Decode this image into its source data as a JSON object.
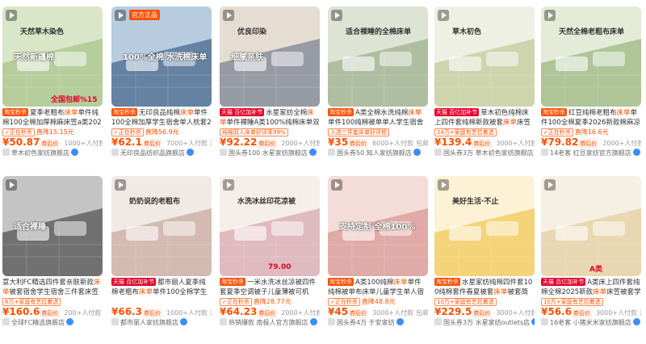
{
  "products": [
    {
      "badge": "",
      "overlay_top": "天然草木染色",
      "overlay_mid": "天然新疆棉",
      "overlay_bottom": "全国包邮%15",
      "tag": "淘宝秒杀",
      "title_pre": "夏季老粗布",
      "title_hl": "床单",
      "title_post": "单件纯棉100全棉加厚棉麻床笠a类2026",
      "promo_badge": "✓正在秒杀",
      "promo_text": "直降15.15元",
      "price": "¥50.87",
      "price_suffix": "券后价",
      "sales": "1000+人付款",
      "ship": "包邮",
      "shop": "草木初色家纺旗舰店",
      "bg1": "#d9e6c8",
      "bg2": "#a9c48e"
    },
    {
      "badge": "官方正品",
      "overlay_top": "",
      "overlay_mid": "100%全棉 水洗棉床单",
      "overlay_bottom": "",
      "tag": "淘宝秒杀",
      "title_pre": "无印良品纯棉",
      "title_hl": "床单",
      "title_post": "单件100全棉加厚学生宿舍单人枕套2026",
      "promo_badge": "✓正在秒杀",
      "promo_text": "直降56.9元",
      "price": "¥62.1",
      "price_suffix": "券后价",
      "sales": "7000+人付款",
      "ship": "江苏",
      "shop": "无印良品纺织品旗舰店",
      "bg1": "#b8cce0",
      "bg2": "#4a6a8e"
    },
    {
      "badge": "",
      "overlay_top": "优良印染",
      "overlay_mid": "细腻亲肤",
      "overlay_bottom": "",
      "tag": "天猫 百亿加补节",
      "title_pre": "水星家纺全棉",
      "title_hl": "床单",
      "title_post": "单件裸睡A类100%纯棉床单双人",
      "promo_badge": "纯棉双人床单好评率99%",
      "promo_text": "",
      "price": "¥92.22",
      "price_suffix": "券后价",
      "sales": "2000+人付款",
      "ship": "包邮",
      "shop": "国头券100 水星家纺旗舰店",
      "bg1": "#e6ddd2",
      "bg2": "#7b8494"
    },
    {
      "badge": "",
      "overlay_top": "适合裸睡的全棉床单",
      "overlay_mid": "",
      "overlay_bottom": "",
      "tag": "淘宝秒杀",
      "title_pre": "A类全棉水洗纯棉",
      "title_hl": "床单",
      "title_post": "单件100纯棉被单单人学生宿舍单人被单",
      "promo_badge": "入选三件套床单好评榜",
      "promo_text": "",
      "price": "¥35",
      "price_suffix": "券后价",
      "sales": "6000+人付款",
      "ship": "包邮",
      "shop": "国头券50 知人家纺旗舰店",
      "bg1": "#dde4d4",
      "bg2": "#9fb08f"
    },
    {
      "badge": "",
      "overlay_top": "草木初色",
      "overlay_mid": "",
      "overlay_bottom": "",
      "tag": "天猫 百亿加补节",
      "title_pre": "草木初色纯棉床上四件套纯棉新款被套",
      "title_hl": "床单",
      "title_post": "床笠单人",
      "promo_badge": "24万+家庭有艺拉着选",
      "promo_text": "",
      "price": "¥139.4",
      "price_suffix": "券后价",
      "sales": "3000+人付款",
      "ship": "包邮",
      "shop": "国头券3万 草木初色家纺旗舰店",
      "bg1": "#eef0e4",
      "bg2": "#c3cc9b"
    },
    {
      "badge": "",
      "overlay_top": "天然全棉老粗布床单",
      "overlay_mid": "",
      "overlay_bottom": "",
      "tag": "淘宝秒杀",
      "title_pre": "红豆纯棉老粗布",
      "title_hl": "床单",
      "title_post": "单件100全棉夏季2026新款棉麻凉爽床",
      "promo_badge": "✓正在秒杀",
      "promo_text": "直降16.6元",
      "price": "¥79.82",
      "price_suffix": "券后价",
      "sales": "2000+人付款",
      "ship": "江苏",
      "shop": "14老客 红豆家纺官方旗舰店",
      "bg1": "#e4ecd8",
      "bg2": "#9db883"
    },
    {
      "badge": "",
      "overlay_top": "",
      "overlay_mid": "适合裸睡",
      "overlay_bottom": "",
      "tag": "",
      "title_pre": "意大利FC精选四件套亲肤新款",
      "title_hl": "床单",
      "title_post": "被套宿舍学生宿舍三件套床笠床上",
      "promo_badge": "6万+家庭有艺拉着选",
      "promo_text": "",
      "price": "¥160.6",
      "price_suffix": "券后价",
      "sales": "200+人付款",
      "ship": "包邮",
      "shop": "全球FC精选旗舰店",
      "bg1": "#c4c4c4",
      "bg2": "#555555"
    },
    {
      "badge": "",
      "overlay_top": "奶奶说的老粗布",
      "overlay_mid": "",
      "overlay_bottom": "",
      "tag": "天猫 百亿加补节",
      "title_pre": "都市丽人夏季纯棉老粗布",
      "title_hl": "床单",
      "title_post": "单件100全棉学生宿舍单人",
      "promo_badge": "",
      "promo_text": "",
      "price": "¥66.3",
      "price_suffix": "券后价",
      "sales": "1000+人付款",
      "ship": "江苏",
      "shop": "都市丽人家纺旗舰店",
      "bg1": "#f1e9e4",
      "bg2": "#c9a9a0"
    },
    {
      "badge": "",
      "overlay_top": "水洗冰丝印花凉被",
      "overlay_mid": "",
      "overlay_bottom": "79.00",
      "tag": "淘宝秒杀",
      "title_pre": "一米水洗冰丝凉被四件套夏季空调被子儿童薄被可机",
      "title_hl": "",
      "title_post": "",
      "promo_badge": "✓正在秒杀",
      "promo_text": "直降28.77元",
      "price": "¥64.23",
      "price_suffix": "券后价",
      "sales": "2000+人付款",
      "ship": "包邮",
      "shop": "热销爆款 南极人官方旗舰店",
      "bg1": "#f6eee8",
      "bg2": "#d8a8b4"
    },
    {
      "badge": "",
      "overlay_top": "",
      "overlay_mid": "支持定制 全棉100%",
      "overlay_bottom": "",
      "tag": "淘宝秒杀",
      "title_pre": "A类100纯棉",
      "title_hl": "床单",
      "title_post": "单件纯棉被单布床单儿童学生单人宿舍",
      "promo_badge": "✓正在秒杀",
      "promo_text": "直降48.8元",
      "price": "¥45",
      "price_suffix": "券后价",
      "sales": "3000+人付款",
      "ship": "包邮",
      "shop": "国头券4万 于安家纺",
      "bg1": "#f4dcd8",
      "bg2": "#d99a96"
    },
    {
      "badge": "",
      "overlay_top": "美好生活·不止",
      "overlay_mid": "",
      "overlay_bottom": "",
      "tag": "淘宝秒杀",
      "title_pre": "水星家纺纯棉四件套100纯棉套件春夏被套",
      "title_hl": "床单",
      "title_post": "被套简约",
      "promo_badge": "10万+家庭有艺拉着选",
      "promo_text": "",
      "price": "¥229.5",
      "price_suffix": "券后价",
      "sales": "3000+人付款",
      "ship": "江苏",
      "shop": "国头券3万 水星家纺outlets店",
      "bg1": "#fdf2d6",
      "bg2": "#f0c85a"
    },
    {
      "badge": "",
      "overlay_top": "",
      "overlay_mid": "",
      "overlay_bottom": "A类",
      "tag": "天猫 百亿加补节",
      "title_pre": "A类床上四件套纯棉全棉2025新款",
      "title_hl": "床单",
      "title_post": "床笠被套学生宿舍三件套",
      "promo_badge": "10万+家庭有艺拉着选",
      "promo_text": "",
      "price": "¥56.6",
      "price_suffix": "券后价",
      "sales": "3000+人付款",
      "ship": "江苏",
      "shop": "16老客 小猪米米家纺旗舰店",
      "bg1": "#f6f0e2",
      "bg2": "#e4cfa1"
    }
  ]
}
